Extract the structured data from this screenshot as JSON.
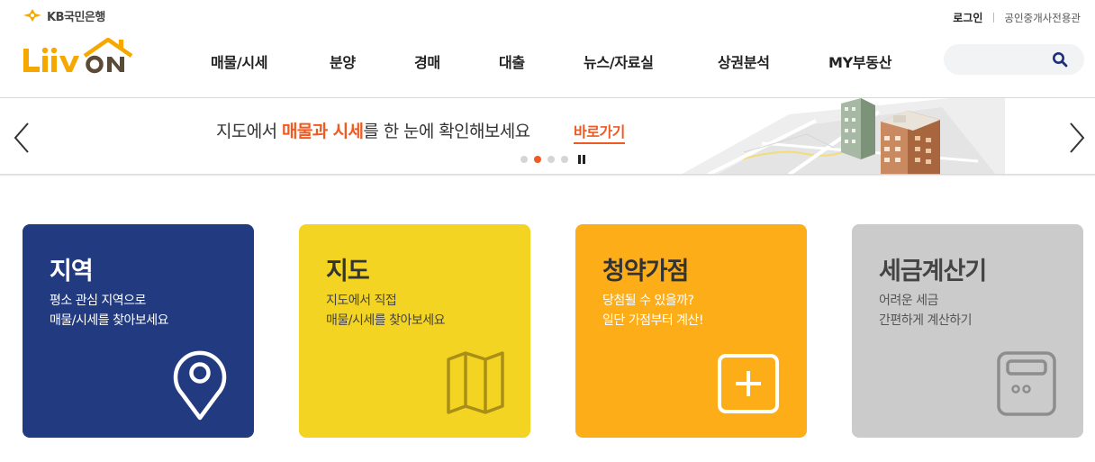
{
  "brand": {
    "bank_name": "KB국민은행",
    "logo_text_left": "LiiV",
    "logo_text_right": "ON",
    "logo_color": "#f6a800",
    "kb_mark_color": "#f6a800"
  },
  "util": {
    "login": "로그인",
    "agent": "공인중개사전용관"
  },
  "nav": {
    "items": [
      {
        "label": "매물/시세"
      },
      {
        "label": "분양"
      },
      {
        "label": "경매"
      },
      {
        "label": "대출"
      },
      {
        "label": "뉴스/자료실"
      },
      {
        "label": "상권분석"
      },
      {
        "label": "MY부동산"
      }
    ]
  },
  "search": {
    "placeholder": "",
    "icon": "search-icon"
  },
  "banner": {
    "text_before": "지도에서 ",
    "text_highlight": "매물과 시세",
    "text_after": "를 한 눈에 확인해보세요",
    "link": "바로가기",
    "slide_count": 4,
    "active_slide": 2,
    "accent": "#ef5a22",
    "prev_icon": "chevron-left-icon",
    "next_icon": "chevron-right-icon",
    "pause_icon": "pause-icon"
  },
  "cards": [
    {
      "title": "지역",
      "desc1": "평소 관심 지역으로",
      "desc2": "매물/시세를 찾아보세요",
      "icon": "location-pin-icon",
      "color": "#223b80"
    },
    {
      "title": "지도",
      "desc1": "지도에서 직접",
      "desc2": "매물/시세를 찾아보세요",
      "icon": "folded-map-icon",
      "color": "#f3d423"
    },
    {
      "title": "청약가점",
      "desc1": "당첨될 수 있을까?",
      "desc2": "일단 가점부터 계산!",
      "icon": "plus-square-icon",
      "color": "#fdad17"
    },
    {
      "title": "세금계산기",
      "desc1": "어려운 세금",
      "desc2": "간편하게 계산하기",
      "icon": "calculator-icon",
      "color": "#cccbcb"
    }
  ]
}
